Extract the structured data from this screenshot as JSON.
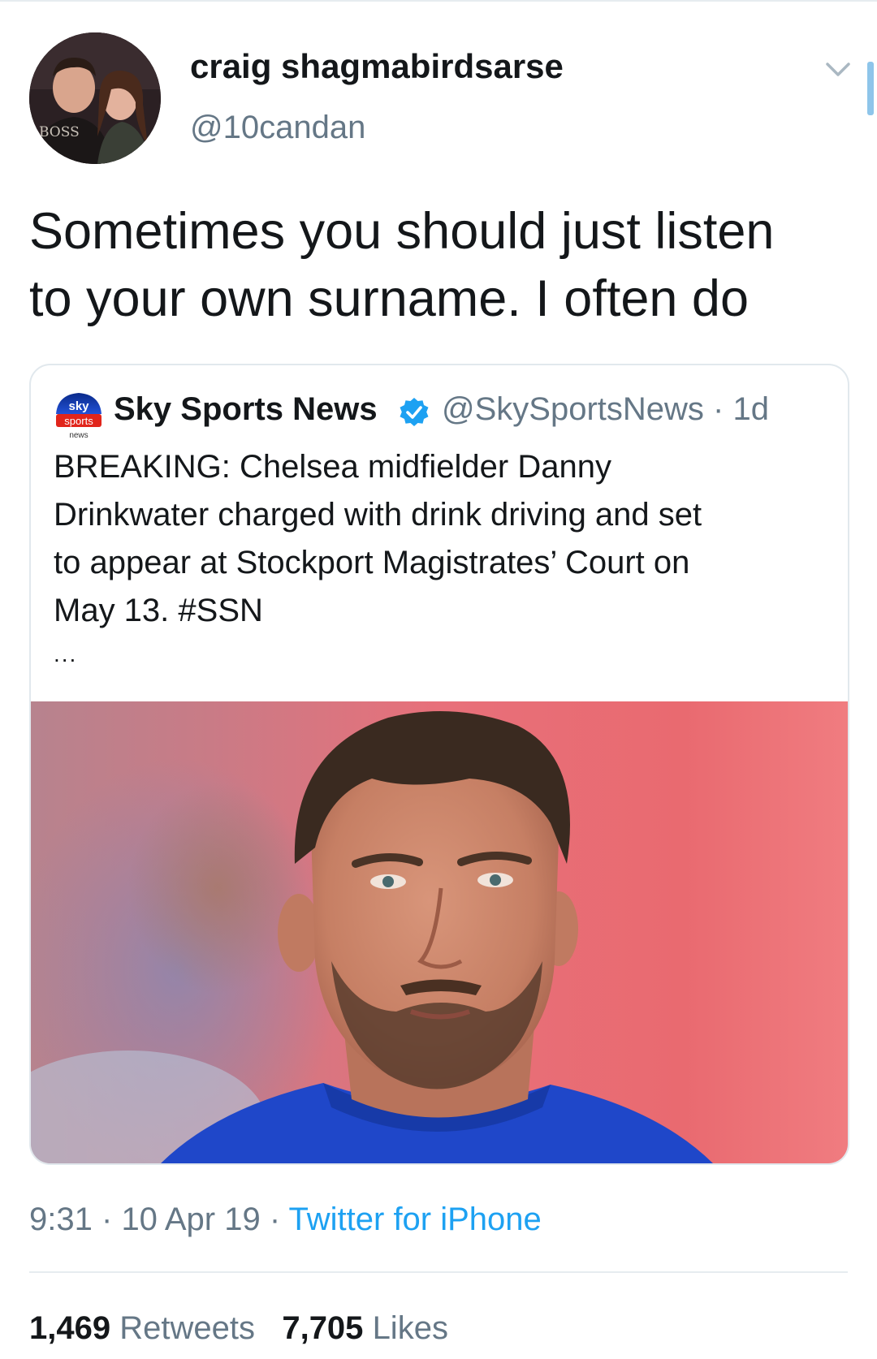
{
  "colors": {
    "accent": "#1da1f2",
    "secondary_text": "#657786",
    "primary_text": "#14171a",
    "border": "#e1e8ed"
  },
  "tweet": {
    "author": {
      "display_name": "craig shagmabirdsarse",
      "handle": "@10candan",
      "avatar_caption": "BOSS"
    },
    "menu_icon": "chevron-down-icon",
    "text_lines": [
      "Sometimes you should just listen",
      "to your own surname. I often do"
    ],
    "quoted": {
      "logo": {
        "line1": "sky",
        "line2": "sports",
        "line3": "news"
      },
      "display_name": "Sky Sports News",
      "verified_icon": "verified-badge-icon",
      "handle": "@SkySportsNews",
      "separator": "·",
      "age": "1d",
      "text_lines": [
        "BREAKING: Chelsea midfielder Danny",
        "Drinkwater charged with drink driving and set",
        "to appear at Stockport Magistrates’ Court on",
        "May 13. #SSN"
      ],
      "truncation": "...",
      "media_subject": "player-portrait"
    },
    "time": "9:31",
    "sep1": "·",
    "date": "10 Apr 19",
    "sep2": "·",
    "source": "Twitter for iPhone",
    "retweets": {
      "count": "1,469",
      "label": "Retweets"
    },
    "likes": {
      "count": "7,705",
      "label": "Likes"
    }
  }
}
